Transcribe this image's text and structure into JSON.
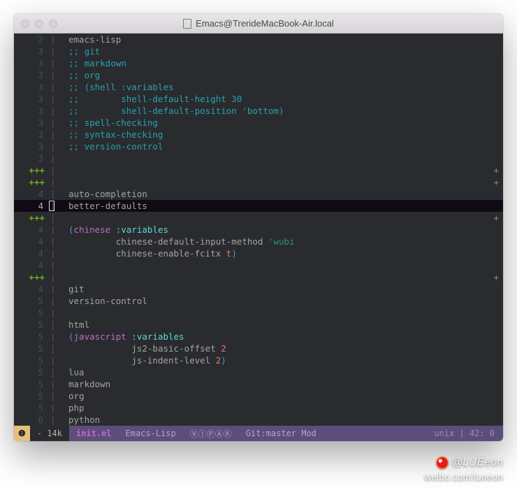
{
  "window": {
    "title": "Emacs@TrerideMacBook-Air.local"
  },
  "modeline": {
    "warn_icon": "❶",
    "state": "-",
    "size": "14k",
    "filename": "init.el",
    "major_mode": "Emacs-Lisp",
    "minor_modes": "ⓋⒾⓅⒶⓀ",
    "vc": "Git:master Mod",
    "right": "unix | 42: 0"
  },
  "watermark": {
    "handle": "@LUEeon",
    "site": "weibo.com/lueeon"
  },
  "lines": [
    {
      "n": "2",
      "type": "sym",
      "text": "emacs-lisp"
    },
    {
      "n": "3",
      "type": "comment",
      "text": ";; git"
    },
    {
      "n": "3",
      "type": "comment",
      "text": ";; markdown"
    },
    {
      "n": "3",
      "type": "comment",
      "text": ";; org"
    },
    {
      "n": "3",
      "type": "comment",
      "text": ";; (shell :variables"
    },
    {
      "n": "3",
      "type": "comment",
      "text": ";;        shell-default-height 30"
    },
    {
      "n": "3",
      "type": "comment",
      "text": ";;        shell-default-position 'bottom)"
    },
    {
      "n": "3",
      "type": "comment",
      "text": ";; spell-checking"
    },
    {
      "n": "3",
      "type": "comment",
      "text": ";; syntax-checking"
    },
    {
      "n": "3",
      "type": "comment",
      "text": ";; version-control"
    },
    {
      "n": "3",
      "type": "blank",
      "text": ""
    },
    {
      "n": "+++",
      "type": "plusrow",
      "text": "",
      "eolplus": true
    },
    {
      "n": "+++",
      "type": "plusrow",
      "text": "",
      "eolplus": true
    },
    {
      "n": "4",
      "type": "sym",
      "text": "auto-completion"
    },
    {
      "n": "4",
      "type": "sym",
      "text": "better-defaults",
      "hl": true,
      "cursor": true
    },
    {
      "n": "+++",
      "type": "plusrow",
      "text": "",
      "eolplus": true
    },
    {
      "n": "4",
      "type": "chinese1",
      "p1": "(",
      "fn": "chinese",
      "kw": " :variables"
    },
    {
      "n": "4",
      "type": "chinese2",
      "indent": "         ",
      "sym": "chinese-default-input-method ",
      "str": "'wubi"
    },
    {
      "n": "4",
      "type": "chinese3",
      "indent": "         ",
      "sym": "chinese-enable-fcitx ",
      "num": "t",
      "p2": ")"
    },
    {
      "n": "4",
      "type": "blank",
      "text": ""
    },
    {
      "n": "+++",
      "type": "plusrow",
      "text": "",
      "eolplus": true
    },
    {
      "n": "4",
      "type": "sym",
      "text": "git"
    },
    {
      "n": "5",
      "type": "sym",
      "text": "version-control"
    },
    {
      "n": "5",
      "type": "blank",
      "text": ""
    },
    {
      "n": "5",
      "type": "sym",
      "text": "html"
    },
    {
      "n": "5",
      "type": "js1",
      "p1": "(",
      "fn": "javascript",
      "kw": " :variables"
    },
    {
      "n": "5",
      "type": "js2",
      "indent": "            ",
      "sym": "js2-basic-offset ",
      "num": "2"
    },
    {
      "n": "5",
      "type": "js3",
      "indent": "            ",
      "sym": "js-indent-level ",
      "num": "2",
      "p2": ")"
    },
    {
      "n": "5",
      "type": "sym",
      "text": "lua"
    },
    {
      "n": "5",
      "type": "sym",
      "text": "markdown"
    },
    {
      "n": "5",
      "type": "sym",
      "text": "org"
    },
    {
      "n": "5",
      "type": "sym",
      "text": "php"
    },
    {
      "n": "6",
      "type": "sym",
      "text": "python"
    }
  ]
}
